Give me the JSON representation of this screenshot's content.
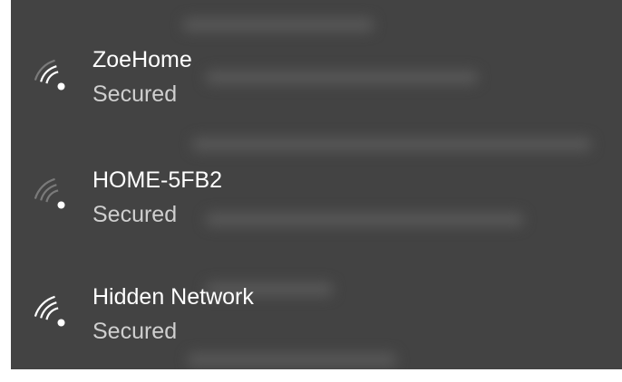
{
  "networks": [
    {
      "ssid": "ZoeHome",
      "status": "Secured",
      "icon": "wifi-signal-icon",
      "signal_bars": 3
    },
    {
      "ssid": "HOME-5FB2",
      "status": "Secured",
      "icon": "wifi-signal-icon",
      "signal_bars": 1
    },
    {
      "ssid": "Hidden Network",
      "status": "Secured",
      "icon": "wifi-signal-icon",
      "signal_bars": 4
    }
  ],
  "colors": {
    "flyout_background": "#434343",
    "text_primary": "#ffffff",
    "text_secondary": "#cfcfcf",
    "signal_active": "#ffffff",
    "signal_inactive": "#7a7a7a"
  }
}
